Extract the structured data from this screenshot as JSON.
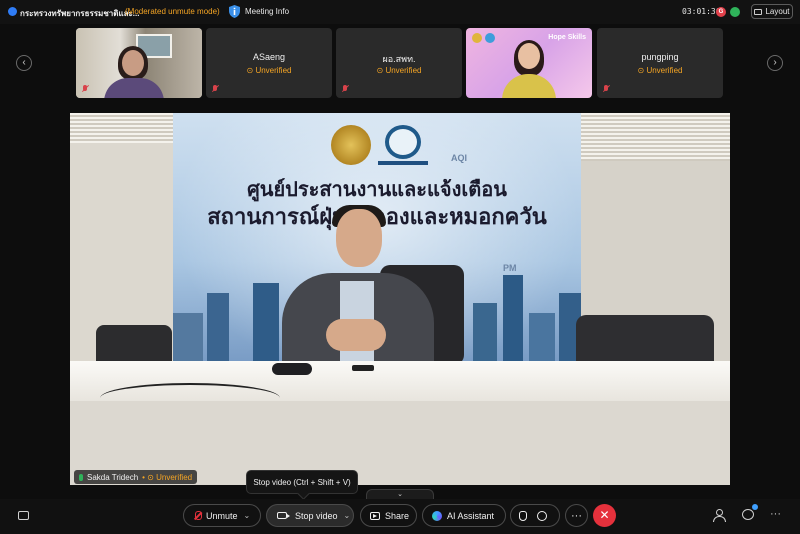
{
  "topbar": {
    "meeting_title": "กระทรวงทรัพยากรธรรมชาติและ...",
    "mode_label": "(Moderated unmute mode)",
    "info_label": "Meeting Info",
    "clock": "03:01:36",
    "rec_badge": "G",
    "layout_label": "Layout"
  },
  "participants": [
    {
      "name": "",
      "status": "",
      "type": "video",
      "muted": true
    },
    {
      "name": "ASaeng",
      "status": "Unverified",
      "type": "avatar",
      "muted": true
    },
    {
      "name": "ผอ.สพท.",
      "status": "Unverified",
      "type": "avatar",
      "muted": true
    },
    {
      "name": "",
      "status": "",
      "type": "video",
      "muted": false,
      "overlay_brand": "Hope Skills"
    },
    {
      "name": "pungping",
      "status": "Unverified",
      "type": "avatar",
      "muted": true
    }
  ],
  "main_video": {
    "banner_line1": "ศูนย์ประสานงานและแจ้งเตือน",
    "banner_line2": "สถานการณ์ฝุ่นละอองและหมอกควัน",
    "aqi_label": "AQI",
    "pm_label": "PM",
    "speaker_name": "Sakda Tridech",
    "speaker_status": "Unverified"
  },
  "tooltip": "Stop video (Ctrl + Shift + V)",
  "controls": {
    "unmute": "Unmute",
    "stop_video": "Stop video",
    "share": "Share",
    "ai_assistant": "AI Assistant",
    "more": "···",
    "end": "✕",
    "overflow": "···"
  },
  "colors": {
    "accent_orange": "#f5a524",
    "end_red": "#e5313c",
    "mic_green": "#2fb35a"
  }
}
